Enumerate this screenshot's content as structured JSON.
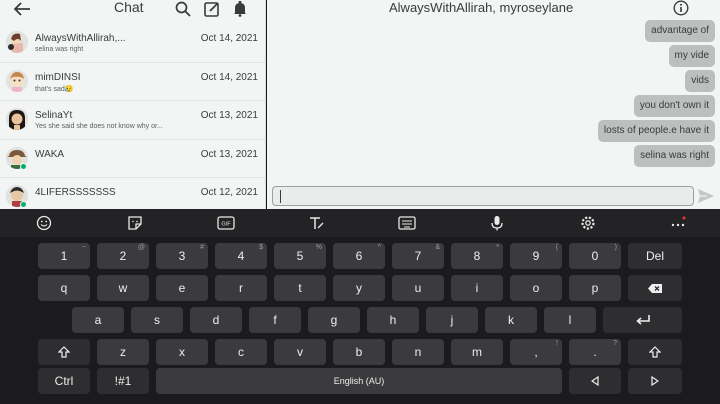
{
  "left_panel": {
    "title": "Chat",
    "conversations": [
      {
        "name": "AlwaysWithAllirah,...",
        "snippet": "selina was right",
        "date": "Oct 14, 2021",
        "online": false
      },
      {
        "name": "mimDINSI",
        "snippet": "that's sad😥",
        "date": "Oct 14, 2021",
        "online": false
      },
      {
        "name": "SelinaYt",
        "snippet": "Yes she said she does not know why or...",
        "date": "Oct 13, 2021",
        "online": false
      },
      {
        "name": "WAKA",
        "snippet": "",
        "date": "Oct 13, 2021",
        "online": true
      },
      {
        "name": "4LIFERSSSSSSS",
        "snippet": "",
        "date": "Oct 12, 2021",
        "online": true
      }
    ]
  },
  "conversation": {
    "title": "AlwaysWithAllirah, myroseylane",
    "messages": [
      "advantage of",
      "my vide",
      "vids",
      "you don't own it",
      "losts of people.e have it",
      "selina was right"
    ],
    "composer_value": ""
  },
  "keyboard": {
    "row1": [
      {
        "label": "1",
        "sym": "~"
      },
      {
        "label": "2",
        "sym": "@"
      },
      {
        "label": "3",
        "sym": "#"
      },
      {
        "label": "4",
        "sym": "$"
      },
      {
        "label": "5",
        "sym": "%"
      },
      {
        "label": "6",
        "sym": "^"
      },
      {
        "label": "7",
        "sym": "&"
      },
      {
        "label": "8",
        "sym": "*"
      },
      {
        "label": "9",
        "sym": "("
      },
      {
        "label": "0",
        "sym": ")"
      },
      {
        "label": "Del",
        "sym": ""
      }
    ],
    "row2": [
      "q",
      "w",
      "e",
      "r",
      "t",
      "y",
      "u",
      "i",
      "o",
      "p"
    ],
    "row3": [
      "a",
      "s",
      "d",
      "f",
      "g",
      "h",
      "j",
      "k",
      "l"
    ],
    "row4": [
      {
        "label": "z",
        "sym": ""
      },
      {
        "label": "x",
        "sym": ""
      },
      {
        "label": "c",
        "sym": ""
      },
      {
        "label": "v",
        "sym": ""
      },
      {
        "label": "b",
        "sym": ""
      },
      {
        "label": "n",
        "sym": ""
      },
      {
        "label": "m",
        "sym": ""
      },
      {
        "label": ",",
        "sym": "!"
      },
      {
        "label": ".",
        "sym": "?"
      }
    ],
    "row5": {
      "ctrl": "Ctrl",
      "symbols": "!#1",
      "space": "English (AU)"
    }
  },
  "colors": {
    "panel_bg": "#f2f5f3",
    "bubble_bg": "#bdbebe",
    "keyboard_bg": "#1b1b1d",
    "key_bg": "#3b3b3d",
    "online_green": "#00b06f",
    "notification_red": "#e53935"
  },
  "icons": {
    "header": [
      "back-arrow-icon",
      "search-icon",
      "compose-icon",
      "bell-icon",
      "info-icon",
      "send-icon"
    ],
    "keyboard_toolbar": [
      "emoji-icon",
      "sticker-icon",
      "gif-icon",
      "text-style-icon",
      "keyboard-layout-icon",
      "microphone-icon",
      "settings-icon",
      "more-icon"
    ]
  }
}
